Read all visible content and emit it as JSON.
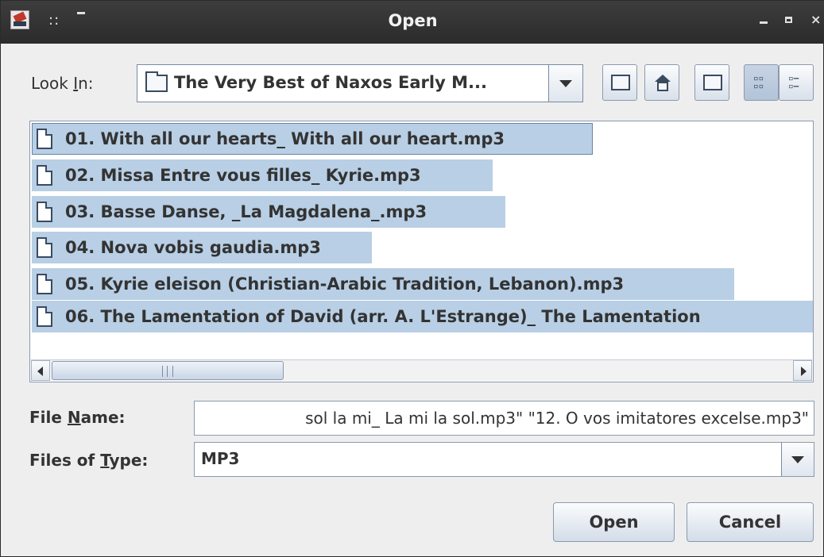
{
  "window": {
    "title": "Open"
  },
  "titlebar_controls": {
    "grip": "::",
    "close": "×"
  },
  "look_in": {
    "label_pre": "Look ",
    "label_mnemonic": "I",
    "label_post": "n:",
    "value": "The Very Best of Naxos Early M..."
  },
  "toolbar": {
    "buttons": [
      "up-one-level",
      "home",
      "new-folder",
      "list-view",
      "details-view"
    ]
  },
  "files": [
    {
      "name": "01. With all our hearts_ With all our heart.mp3",
      "selected": true,
      "focused": true
    },
    {
      "name": "02. Missa Entre vous filles_ Kyrie.mp3",
      "selected": true
    },
    {
      "name": "03. Basse Danse, _La Magdalena_.mp3",
      "selected": true
    },
    {
      "name": "04. Nova vobis gaudia.mp3",
      "selected": true
    },
    {
      "name": "05. Kyrie eleison (Christian-Arabic Tradition, Lebanon).mp3",
      "selected": true
    },
    {
      "name": "06. The Lamentation of David (arr. A. L'Estrange)_ The Lamentation",
      "selected": true
    }
  ],
  "file_name": {
    "label_pre": "File ",
    "label_mnemonic": "N",
    "label_post": "ame:",
    "value": "sol la mi_ La mi la sol.mp3\" \"12. O vos imitatores excelse.mp3\""
  },
  "file_type": {
    "label_pre": "Files of ",
    "label_mnemonic": "T",
    "label_post": "ype:",
    "value": "MP3"
  },
  "buttons": {
    "open": "Open",
    "cancel": "Cancel"
  },
  "colors": {
    "selection": "#b8cfe5",
    "titlebar": "#2b2b2b",
    "background": "#eeeeee"
  }
}
